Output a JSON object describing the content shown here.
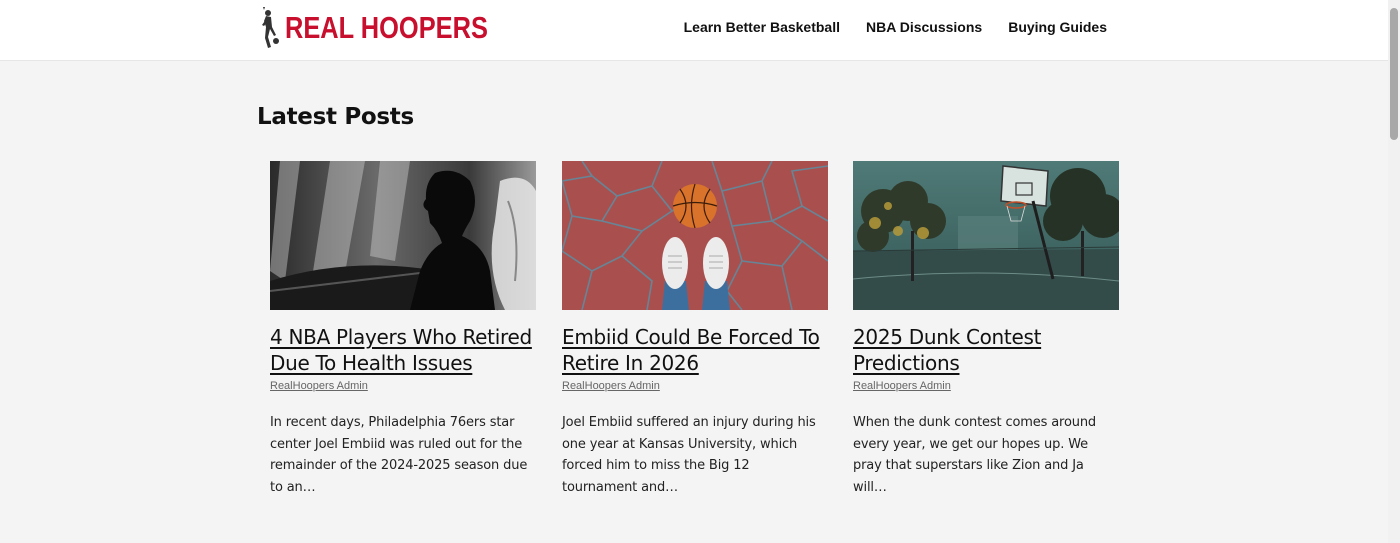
{
  "header": {
    "logo_text": "REAL HOOPERS",
    "logo_icon": "player-dunk-icon",
    "nav": [
      {
        "label": "Learn Better Basketball"
      },
      {
        "label": "NBA Discussions"
      },
      {
        "label": "Buying Guides"
      }
    ]
  },
  "main": {
    "section_title": "Latest Posts",
    "posts": [
      {
        "title": "4 NBA Players Who Retired Due To Health Issues",
        "author": "RealHoopers Admin",
        "excerpt": "In recent days, Philadelphia 76ers star center Joel Embiid was ruled out for the remainder of the 2024-2025 season due to an…",
        "image": "silhouette-player-hospital-image"
      },
      {
        "title": "Embiid Could Be Forced To Retire In 2026",
        "author": "RealHoopers Admin",
        "excerpt": "Joel Embiid suffered an injury during his one year at Kansas University, which forced him to miss the Big 12 tournament and…",
        "image": "basketball-sneakers-court-image"
      },
      {
        "title": "2025 Dunk Contest Predictions",
        "author": "RealHoopers Admin",
        "excerpt": "When the dunk contest comes around every year, we get our hopes up. We pray that superstars like Zion and Ja will…",
        "image": "foggy-outdoor-hoop-image"
      }
    ]
  },
  "colors": {
    "brand": "#c8102e",
    "background": "#f4f4f4",
    "header_bg": "#ffffff"
  }
}
